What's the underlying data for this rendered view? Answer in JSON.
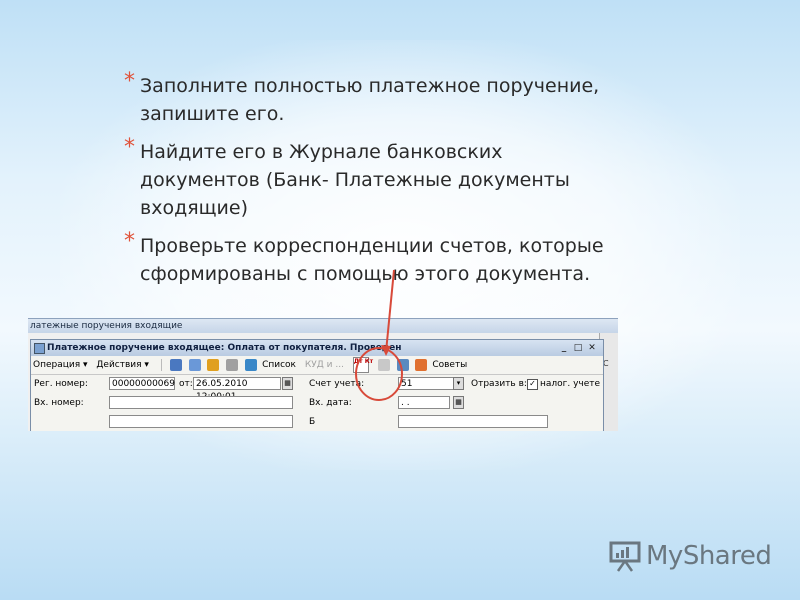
{
  "bullets": [
    "Заполните полностью платежное поручение,\nзапишите его.",
    "Найдите его в Журнале банковских\nдокументов (Банк- Платежные документы\nвходящие)",
    "Проверьте корреспонденции счетов, которые\nсформированы с помощью этого документа."
  ],
  "bullet_marker": "*",
  "screenshot": {
    "outer_title": "латежные поручения входящие",
    "window_title": "Платежное поручение входящее: Оплата от покупателя. Проведен",
    "window_controls": [
      "_",
      "□",
      "✕"
    ],
    "toolbar": {
      "operation": "Операция ▾",
      "actions": "Действия ▾",
      "list": "Список",
      "kud": "КУД и ...",
      "dtkt": "Дт Кт",
      "tips": "Советы"
    },
    "rows": {
      "reg_label": "Рег. номер:",
      "reg_value": "00000000069",
      "from_label": "от:",
      "date_value": "26.05.2010 12:00:01",
      "account_label": "Счет учета:",
      "account_value": "51",
      "reflect_label": "Отразить в:",
      "tax_label": "налог. учете",
      "in_number_label": "Вх. номер:",
      "in_date_label": "Вх. дата:",
      "in_date_value": ". .",
      "partial_label": "Б"
    },
    "strip_char": "С"
  },
  "logo": {
    "name": "MyShared",
    "icon": "presentation-board-icon"
  },
  "colors": {
    "star": "#e0523a",
    "circle": "#d84a3a",
    "arrow": "#d84a3a"
  }
}
